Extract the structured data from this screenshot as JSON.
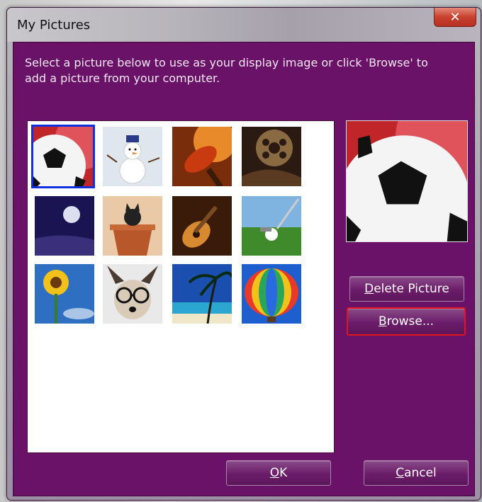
{
  "window": {
    "title": "My Pictures",
    "close_glyph": "✕"
  },
  "instruction": "Select a picture below to use as your display image or click 'Browse' to add a picture from your computer.",
  "thumbnails": [
    {
      "name": "soccer-ball-picture",
      "selected": true
    },
    {
      "name": "snowman-picture",
      "selected": false
    },
    {
      "name": "tennis-racket-picture",
      "selected": false
    },
    {
      "name": "film-reel-picture",
      "selected": false
    },
    {
      "name": "moon-picture",
      "selected": false
    },
    {
      "name": "cat-in-pot-picture",
      "selected": false
    },
    {
      "name": "guitar-picture",
      "selected": false
    },
    {
      "name": "golf-ball-picture",
      "selected": false
    },
    {
      "name": "sunflower-picture",
      "selected": false
    },
    {
      "name": "dog-with-glasses-picture",
      "selected": false
    },
    {
      "name": "beach-palms-picture",
      "selected": false
    },
    {
      "name": "hot-air-balloon-picture",
      "selected": false
    }
  ],
  "buttons": {
    "delete": {
      "mnemonic": "D",
      "rest": "elete Picture"
    },
    "browse": {
      "mnemonic": "B",
      "rest": "rowse..."
    },
    "ok": {
      "mnemonic": "O",
      "rest": "K"
    },
    "cancel": {
      "mnemonic": "C",
      "rest": "ancel"
    }
  },
  "colors": {
    "dialog_background": "#6a1268",
    "selection_border": "#1030e0",
    "focus_border": "#e3141c"
  }
}
